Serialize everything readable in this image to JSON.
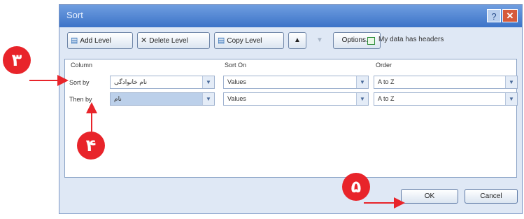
{
  "window": {
    "title": "Sort",
    "help_glyph": "?",
    "close_glyph": "✕"
  },
  "toolbar": {
    "add_level": "Add Level",
    "delete_level": "Delete Level",
    "copy_level": "Copy Level",
    "move_up": "▲",
    "move_down": "▼",
    "options": "Options...",
    "my_data_has_headers": "My data has headers"
  },
  "columns": {
    "column": "Column",
    "sort_on": "Sort On",
    "order": "Order"
  },
  "rows": [
    {
      "label": "Sort by",
      "column": "نام خانوادگی",
      "sort_on": "Values",
      "order": "A to Z"
    },
    {
      "label": "Then by",
      "column": "نام",
      "sort_on": "Values",
      "order": "A to Z"
    }
  ],
  "buttons": {
    "ok": "OK",
    "cancel": "Cancel"
  },
  "annotations": {
    "step3": "۳",
    "step4": "۴",
    "step5": "۵"
  },
  "colors": {
    "badge": "#e8242a",
    "title_bar": "#3c73c8",
    "dialog_bg": "#dfe8f5"
  }
}
